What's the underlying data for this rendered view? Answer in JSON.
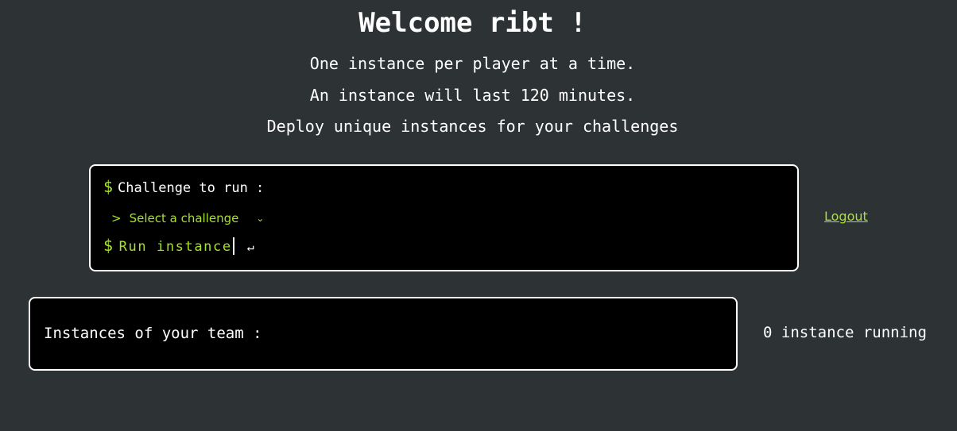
{
  "header": {
    "title": "Welcome ribt !",
    "lines": [
      "One instance per player at a time.",
      "An instance will last 120 minutes.",
      "Deploy unique instances for your challenges"
    ]
  },
  "deploy_panel": {
    "prompt_symbol": "$",
    "challenge_label": "Challenge to run :",
    "select_prompt": ">",
    "select_value": "Select a challenge",
    "run_label": "Run instance",
    "enter_symbol": "↵"
  },
  "logout_label": "Logout",
  "instances_panel": {
    "label": "Instances of your team :"
  },
  "instance_count": "0 instance running",
  "colors": {
    "background": "#2d3335",
    "accent": "#a6e22e",
    "panel": "#000000",
    "border": "#ffffff"
  },
  "icons": {
    "select": "chevron-down-icon",
    "enter": "enter-icon"
  }
}
